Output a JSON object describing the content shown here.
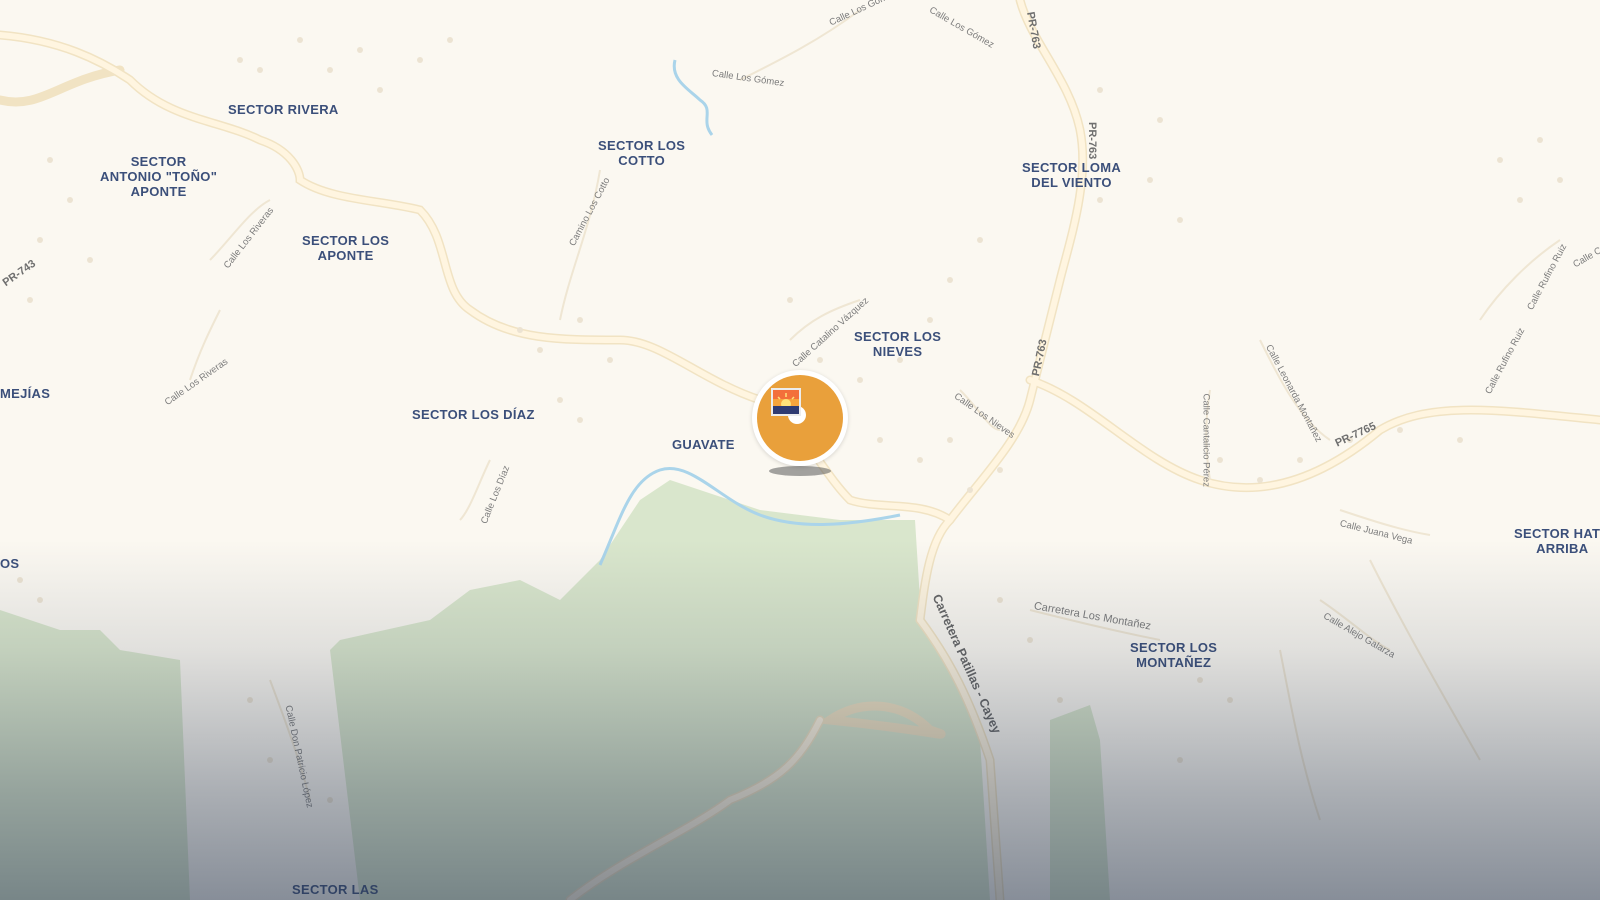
{
  "map": {
    "colors": {
      "land": "#fbf8f1",
      "road": "#fff2d6",
      "road_outline": "#f1e3c3",
      "forest": "#d9e6cc",
      "water": "#aad4ea",
      "place_label": "#3b4f7a",
      "marker": "#e9a03b"
    },
    "places": [
      {
        "id": "rivera",
        "text": "SECTOR RIVERA"
      },
      {
        "id": "antonio",
        "text": "SECTOR\nANTONIO \"TOÑO\"\nAPONTE"
      },
      {
        "id": "cotto",
        "text": "SECTOR LOS\nCOTTO"
      },
      {
        "id": "loma",
        "text": "SECTOR LOMA\nDEL VIENTO"
      },
      {
        "id": "aponte",
        "text": "SECTOR LOS\nAPONTE"
      },
      {
        "id": "nieves",
        "text": "SECTOR LOS\nNIEVES"
      },
      {
        "id": "mejias",
        "text": "MEJÍAS"
      },
      {
        "id": "diaz",
        "text": "SECTOR LOS DÍAZ"
      },
      {
        "id": "guavate",
        "text": "GUAVATE"
      },
      {
        "id": "os",
        "text": "OS"
      },
      {
        "id": "hato",
        "text": "SECTOR HATO\nARRIBA"
      },
      {
        "id": "montanez",
        "text": "SECTOR LOS\nMONTAÑEZ"
      },
      {
        "id": "las",
        "text": "SECTOR LAS"
      }
    ],
    "streets": [
      {
        "id": "gomez1",
        "text": "Calle Los Gómez"
      },
      {
        "id": "gomez2",
        "text": "Calle Los Gómez"
      },
      {
        "id": "gomez3",
        "text": "Calle Los Gómez"
      },
      {
        "id": "cotto_cam",
        "text": "Camino Los Cotto"
      },
      {
        "id": "riveras1",
        "text": "Calle Los Riveras"
      },
      {
        "id": "riveras2",
        "text": "Calle Los Riveras"
      },
      {
        "id": "catalino",
        "text": "Calle Catalino Vázquez"
      },
      {
        "id": "nieves_c",
        "text": "Calle Los Nieves"
      },
      {
        "id": "diaz_c",
        "text": "Calle Los Díaz"
      },
      {
        "id": "cantalicio",
        "text": "Calle Cantalicio Pérez"
      },
      {
        "id": "leonarda",
        "text": "Calle Leonarda Montañez"
      },
      {
        "id": "rufino1",
        "text": "Calle Rufino Ruiz"
      },
      {
        "id": "rufino2",
        "text": "Calle Rufino Ruiz"
      },
      {
        "id": "calle_c",
        "text": "Calle C"
      },
      {
        "id": "juana",
        "text": "Calle Juana Vega"
      },
      {
        "id": "alejo",
        "text": "Calle Alejo Galarza"
      },
      {
        "id": "carr_mont",
        "text": "Carretera Los Montañez"
      },
      {
        "id": "patricio",
        "text": "Calle Don Patricio López"
      }
    ],
    "routes": [
      {
        "id": "pr763a",
        "text": "PR-763"
      },
      {
        "id": "pr763b",
        "text": "PR-763"
      },
      {
        "id": "pr763c",
        "text": "PR-763"
      },
      {
        "id": "pr743",
        "text": "PR-743"
      },
      {
        "id": "pr7765",
        "text": "PR-7765"
      }
    ],
    "major_road_label": "Carretera Patillas - Cayey",
    "marker": {
      "icon": "photo-icon"
    }
  }
}
